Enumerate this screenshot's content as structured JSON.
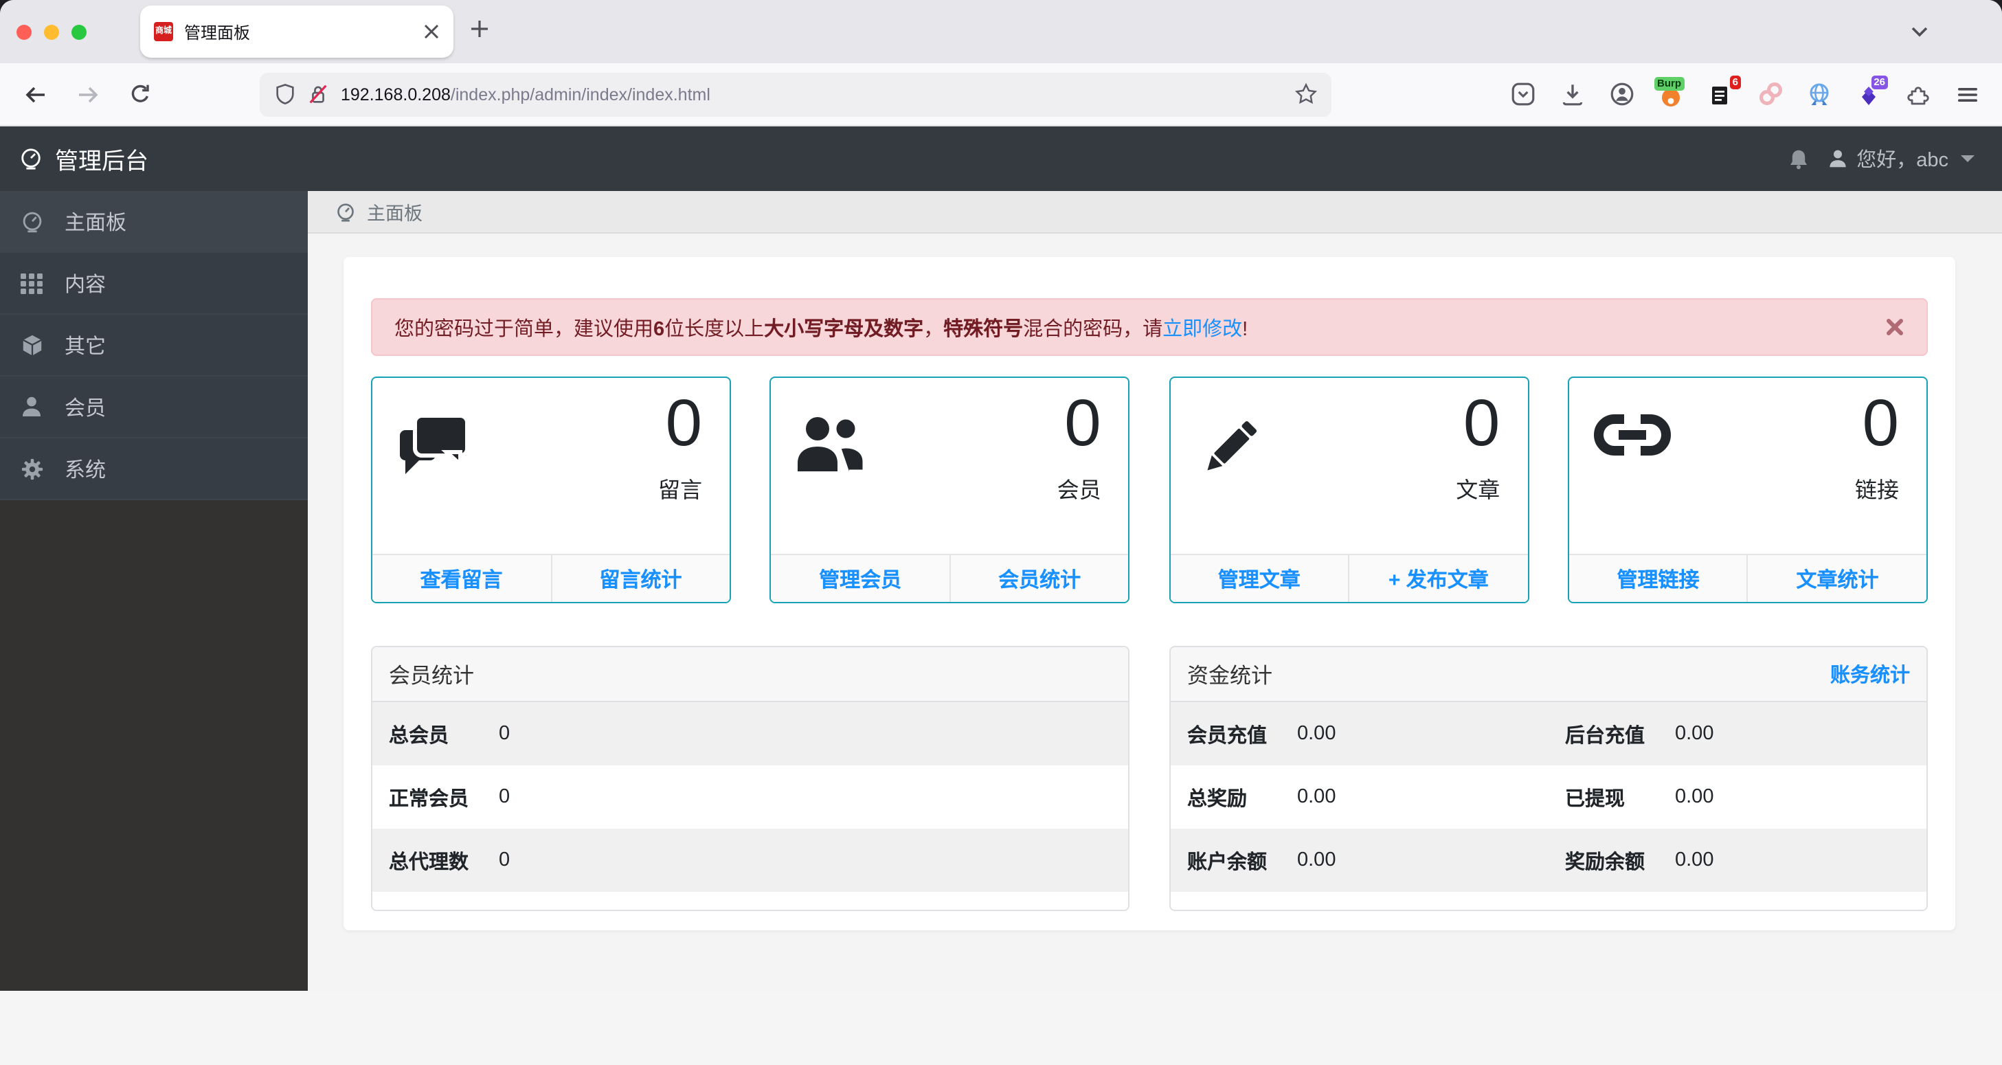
{
  "browser": {
    "tab_title": "管理面板",
    "favicon_text": "商城",
    "url_host": "192.168.0.208",
    "url_path": "/index.php/admin/index/index.html",
    "ext_burp_label": "Burp",
    "ext_badge_red": "6",
    "ext_badge_purple": "26"
  },
  "navbar": {
    "brand": "管理后台",
    "greeting": "您好，",
    "username": "abc"
  },
  "sidebar": {
    "items": [
      {
        "label": "主面板"
      },
      {
        "label": "内容"
      },
      {
        "label": "其它"
      },
      {
        "label": "会员"
      },
      {
        "label": "系统"
      }
    ]
  },
  "breadcrumb": {
    "label": "主面板"
  },
  "alert": {
    "seg1": "您的密码过于简单，建议使用",
    "bold1": "6",
    "seg2": "位长度以上",
    "bold2": "大小写字母及数字",
    "seg3": "，",
    "bold3": "特殊符号",
    "seg4": "混合的密码，请",
    "link": "立即修改",
    "seg5": "!"
  },
  "cards": [
    {
      "value": "0",
      "label": "留言",
      "link1": "查看留言",
      "link2": "留言统计"
    },
    {
      "value": "0",
      "label": "会员",
      "link1": "管理会员",
      "link2": "会员统计"
    },
    {
      "value": "0",
      "label": "文章",
      "link1": "管理文章",
      "link2": "+ 发布文章"
    },
    {
      "value": "0",
      "label": "链接",
      "link1": "管理链接",
      "link2": "文章统计"
    }
  ],
  "member_stats": {
    "title": "会员统计",
    "rows": [
      {
        "label": "总会员",
        "value": "0"
      },
      {
        "label": "正常会员",
        "value": "0"
      },
      {
        "label": "总代理数",
        "value": "0"
      }
    ]
  },
  "fund_stats": {
    "title": "资金统计",
    "action": "账务统计",
    "rows": [
      {
        "l1": "会员充值",
        "v1": "0.00",
        "l2": "后台充值",
        "v2": "0.00"
      },
      {
        "l1": "总奖励",
        "v1": "0.00",
        "l2": "已提现",
        "v2": "0.00"
      },
      {
        "l1": "账户余额",
        "v1": "0.00",
        "l2": "奖励余额",
        "v2": "0.00"
      }
    ]
  },
  "colors": {
    "accent_teal": "#17a2b8",
    "link_blue": "#1890ff",
    "alert_bg": "#f8d7da",
    "alert_text": "#721c24",
    "navbar_dark": "#343a40"
  }
}
